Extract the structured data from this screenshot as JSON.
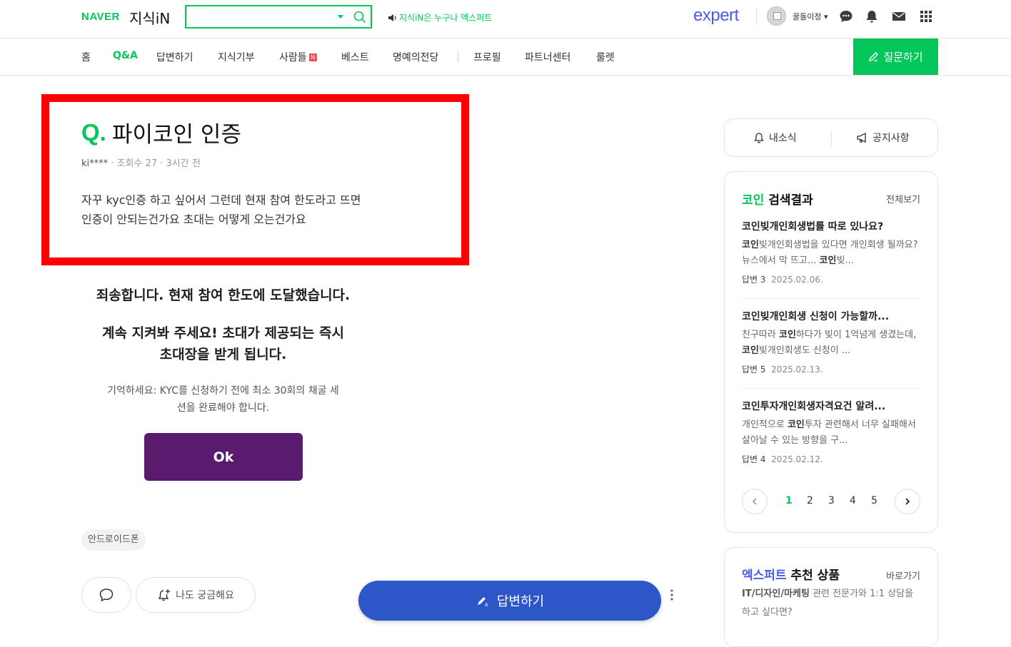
{
  "header": {
    "logo_brand": "NAVER",
    "logo_service": "지식iN",
    "search_value": "",
    "notice_text": "지식iN은 누구나 엑스퍼트",
    "expert_logo": "expert",
    "username": "꿀돌이정"
  },
  "tabs": [
    {
      "label": "홈"
    },
    {
      "label": "Q&A"
    },
    {
      "label": "답변하기"
    },
    {
      "label": "지식기부"
    },
    {
      "label": "사람들"
    },
    {
      "label": "베스트"
    },
    {
      "label": "명예의전당"
    },
    {
      "label": "프로필"
    },
    {
      "label": "파트너센터"
    },
    {
      "label": "룰렛"
    }
  ],
  "tab_badge": "N",
  "ask_button": "질문하기",
  "question": {
    "mark": "Q.",
    "title": "파이코인 인증",
    "author": "ki****",
    "views": "조회수 27",
    "time": "3시간 전",
    "body_line1": "자꾸 kyc인증 하고 싶어서 그런데 현재 참여 한도라고 뜨면",
    "body_line2": "인증이 안되는건가요 초대는 어떻게 오는건가요"
  },
  "popup": {
    "line1": "죄송합니다. 현재 참여 한도에 도달했습니다.",
    "line2": "계속 지켜봐 주세요! 초대가 제공되는 즉시",
    "line3": "초대장을 받게 됩니다.",
    "note_line1": "기억하세요: KYC를 신청하기 전에 최소 30회의 채굴 세",
    "note_line2": "션을 완료해야 합니다.",
    "ok_label": "Ok"
  },
  "tag": "안드로이드폰",
  "actions": {
    "curious_label": "나도 궁금해요",
    "answer_label": "답변하기"
  },
  "sidebar": {
    "notif_label": "내소식",
    "notice_label": "공지사항",
    "results": {
      "keyword": "코인",
      "title_suffix": "검색결과",
      "view_all": "전체보기",
      "items": [
        {
          "title": "코인빚개인회생법률 따로 있나요?",
          "snippet_html": "<b>코인</b>빚개인회생법을 있다면 개인회생 될까요? 뉴스에서 막 뜨고... <b>코인</b>빚...",
          "answer_label": "답변 3",
          "date": "2025.02.06."
        },
        {
          "title": "코인빚개인회생 신청이 가능할까...",
          "snippet_html": "친구따라 <b>코인</b>하다가 빚이 1억넘게 생겼는데, <b>코인</b>빚개인회생도 신청이 ...",
          "answer_label": "답변 5",
          "date": "2025.02.13."
        },
        {
          "title": "코인투자개인회생자격요건 알려...",
          "snippet_html": "개인적으로 <b>코인</b>투자 관련해서 너무 실패해서 살아날 수 있는 방향을 구...",
          "answer_label": "답변 4",
          "date": "2025.02.12."
        }
      ],
      "pages": [
        "1",
        "2",
        "3",
        "4",
        "5"
      ],
      "current_page": "1"
    },
    "expert": {
      "title_hl": "엑스퍼트",
      "title_rest": "추천 상품",
      "link": "바로가기",
      "desc_bold": "IT/디자인/마케팅",
      "desc_rest": " 관련 전문가와 1:1 상담을 하고 싶다면?"
    }
  },
  "colors": {
    "naver_green": "#03c75a",
    "highlight_red": "#ff0000",
    "ok_purple": "#5a1a6e",
    "answer_blue": "#2d56c9",
    "expert_blue": "#4a5be8"
  }
}
